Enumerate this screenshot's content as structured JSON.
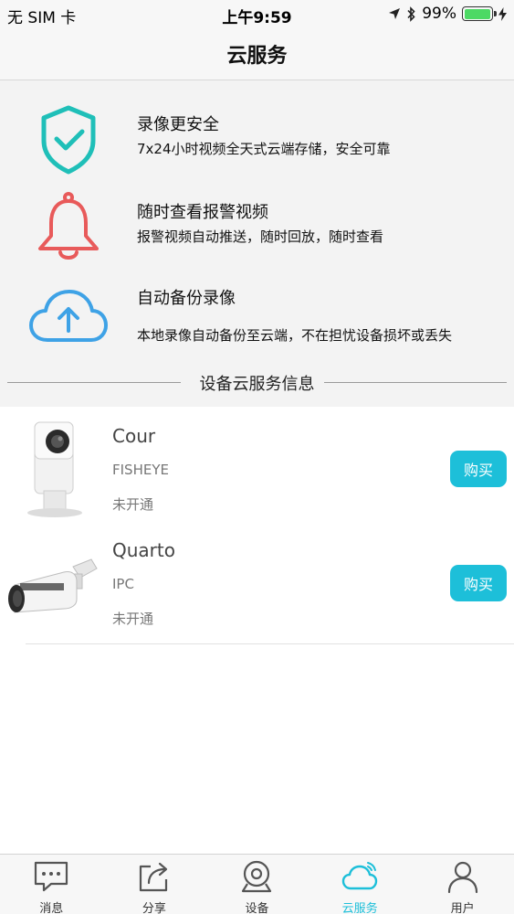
{
  "status_bar": {
    "carrier": "无 SIM 卡",
    "time": "上午9:59",
    "battery": "99%",
    "battery_level": 0.99
  },
  "nav": {
    "title": "云服务"
  },
  "features": [
    {
      "icon": "shield-check-icon",
      "title": "录像更安全",
      "desc": "7x24小时视频全天式云端存储，安全可靠"
    },
    {
      "icon": "bell-icon",
      "title": "随时查看报警视频",
      "desc": "报警视频自动推送，随时回放，随时查看"
    },
    {
      "icon": "cloud-upload-icon",
      "title": "自动备份录像",
      "desc": "本地录像自动备份至云端，不在担忧设备损坏或丢失"
    }
  ],
  "section_title": "设备云服务信息",
  "devices": [
    {
      "name": "Cour",
      "type": "FISHEYE",
      "status": "未开通",
      "buy_label": "购买"
    },
    {
      "name": "Quarto",
      "type": "IPC",
      "status": "未开通",
      "buy_label": "购买"
    }
  ],
  "tabs": [
    {
      "label": "消息",
      "icon": "message-icon"
    },
    {
      "label": "分享",
      "icon": "share-icon"
    },
    {
      "label": "设备",
      "icon": "camera-icon"
    },
    {
      "label": "云服务",
      "icon": "cloud-icon",
      "active": true
    },
    {
      "label": "用户",
      "icon": "user-icon"
    }
  ],
  "colors": {
    "accent": "#1dbfd9",
    "shield": "#1fbfb8",
    "bell": "#e85a5a",
    "cloud": "#3ea2e6"
  }
}
